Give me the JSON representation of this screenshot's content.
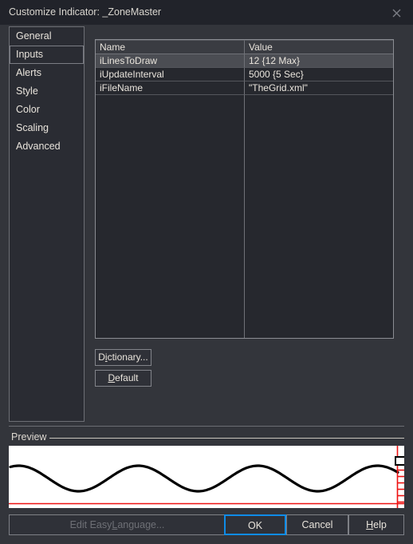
{
  "window": {
    "title": "Customize Indicator: _ZoneMaster",
    "close_icon": "close-icon"
  },
  "sidebar": {
    "items": [
      {
        "label": "General",
        "selected": false
      },
      {
        "label": "Inputs",
        "selected": true
      },
      {
        "label": "Alerts",
        "selected": false
      },
      {
        "label": "Style",
        "selected": false
      },
      {
        "label": "Color",
        "selected": false
      },
      {
        "label": "Scaling",
        "selected": false
      },
      {
        "label": "Advanced",
        "selected": false
      }
    ]
  },
  "inputs_grid": {
    "columns": [
      "Name",
      "Value"
    ],
    "rows": [
      {
        "name": "iLinesToDraw",
        "value": "12 {12 Max}",
        "selected": true
      },
      {
        "name": "iUpdateInterval",
        "value": "5000 {5 Sec}",
        "selected": false
      },
      {
        "name": "iFileName",
        "value": "\"TheGrid.xml\"",
        "selected": false
      }
    ]
  },
  "panel_buttons": {
    "dictionary": {
      "pre": "D",
      "accel": "i",
      "post": "ctionary..."
    },
    "default": {
      "pre": "",
      "accel": "D",
      "post": "efault"
    }
  },
  "preview": {
    "group_label": "Preview",
    "series_color": "#000000",
    "axis_color": "#ee1111",
    "background": "#ffffff"
  },
  "footer": {
    "edit_easylanguage": {
      "pre": "Edit Easy",
      "accel": "L",
      "post": "anguage...",
      "enabled": false
    },
    "ok": "OK",
    "cancel": "Cancel",
    "help": {
      "pre": "",
      "accel": "H",
      "post": "elp"
    }
  },
  "colors": {
    "dialog_bg": "#33353b",
    "titlebar_bg": "#21232a",
    "focus_blue": "#0f8ce8",
    "text": "#e9e4dc",
    "disabled_text": "#6e7076"
  }
}
